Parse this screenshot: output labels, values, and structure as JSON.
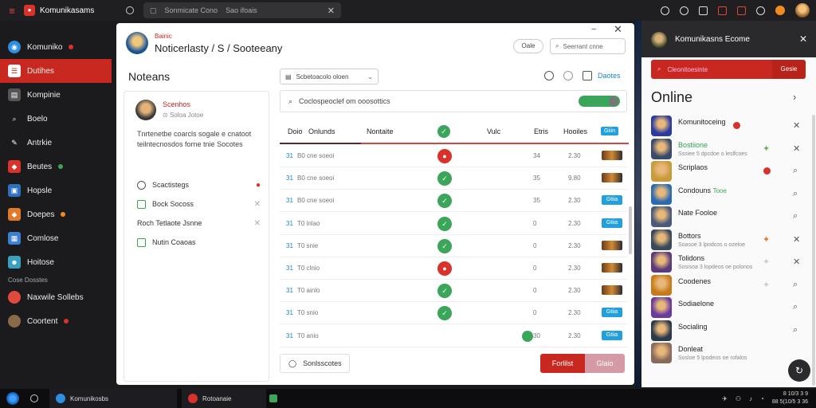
{
  "topbar": {
    "app_title": "Komunikasams",
    "search_text": "Sonmicate Cono",
    "search_hint": "Sao ifoais"
  },
  "nav": {
    "items": [
      {
        "label": "Komuniko",
        "color": "#2e8fe0",
        "badge": "red"
      },
      {
        "label": "Dutihes",
        "color": "#c8281f",
        "active": true
      },
      {
        "label": "Kompinie",
        "color": "#666666"
      },
      {
        "label": "Boelo",
        "color": "#666666"
      },
      {
        "label": "Antrkie",
        "color": "#666666"
      },
      {
        "label": "Beutes",
        "color": "#d8322a",
        "badge": "green"
      },
      {
        "label": "Hopsle",
        "color": "#2e6fbf"
      },
      {
        "label": "Doepes",
        "color": "#e07a2a",
        "badge": "orange"
      },
      {
        "label": "Comlose",
        "color": "#3a7fd0"
      },
      {
        "label": "Hoitose",
        "color": "#3aa0c0"
      }
    ],
    "section_label": "Cose Dosstes",
    "extra": [
      {
        "label": "Naxwile Sollebs",
        "color": "#e04a3a"
      },
      {
        "label": "Coortent",
        "color": "#8a6a4a",
        "badge": "red"
      }
    ]
  },
  "window": {
    "subtitle": "Bainic",
    "title": "Noticerlasty / S / Sooteeany",
    "pill": "Oale",
    "search_placeholder": "Seerrant cnne",
    "page_title": "Noteans",
    "minimize": "−",
    "close": "✕"
  },
  "sidecard": {
    "name": "Scenhos",
    "meta": "Soloa Jotoe",
    "description": "Tnrtenetbe coarcls sogale e cnatoot teilntecnosdos forne tnie Socotes",
    "items": [
      {
        "label": "Scactistegs",
        "end": "●",
        "end_color": "#d8322a",
        "round": true
      },
      {
        "label": "Bock Socoss",
        "end": "✕",
        "end_color": "#aaaaaa"
      },
      {
        "label": "Roch Tetlaote Jsnne",
        "end": "✕",
        "end_color": "#aaaaaa",
        "nobox": true
      },
      {
        "label": "Nutin Coaoas",
        "end": "",
        "end_color": "#aaaaaa"
      }
    ]
  },
  "toolbar": {
    "select_label": "Scbetoacolo oloen",
    "action_label": "Daotes"
  },
  "filter": {
    "placeholder": "Coclospeoclef om ooosottics"
  },
  "table": {
    "headers": {
      "c1": "Doio",
      "c2": "Onlunds",
      "c3": "Nontaite",
      "c4": "Vulc",
      "c5": "Etris",
      "c6": "Hooiles",
      "tag": "Giiin"
    },
    "rows": [
      {
        "id": "31",
        "name": "B0 cne soeoi",
        "status": "bad",
        "a": "34",
        "b": "2.30",
        "c": "img"
      },
      {
        "id": "31",
        "name": "B0 cne soeoi",
        "status": "ok",
        "a": "35",
        "b": "9.80",
        "c": "img"
      },
      {
        "id": "31",
        "name": "B0 cne soeoi",
        "status": "ok",
        "a": "35",
        "b": "2.30",
        "c": "blue",
        "c_label": "Gtiia"
      },
      {
        "id": "31",
        "name": "T0 inlao",
        "status": "ok",
        "a": "0",
        "b": "2.30",
        "c": "blue",
        "c_label": "Gtiia"
      },
      {
        "id": "31",
        "name": "T0 snie",
        "status": "ok",
        "a": "0",
        "b": "2.30",
        "c": "img"
      },
      {
        "id": "31",
        "name": "T0 clnio",
        "status": "bad",
        "a": "0",
        "b": "2.30",
        "c": "img"
      },
      {
        "id": "31",
        "name": "T0 ainlo",
        "status": "ok",
        "a": "0",
        "b": "2.30",
        "c": "img"
      },
      {
        "id": "31",
        "name": "T0 snio",
        "status": "ok",
        "a": "0",
        "b": "2.30",
        "c": "blue",
        "c_label": "Gtiia"
      },
      {
        "id": "31",
        "name": "T0 anio",
        "status": "",
        "a": "30",
        "b": "2.30",
        "c": "blue",
        "c_label": "Gtiia",
        "mini": true
      }
    ]
  },
  "footer": {
    "outline_label": "Sonlsscotes",
    "primary_label": "Forlilst",
    "secondary_label": "Glaio"
  },
  "rpanel": {
    "title": "Komunikasns Ecome",
    "search_placeholder": "Cleonitoesinte",
    "go_label": "Gesie",
    "online_title": "Online",
    "contacts": [
      {
        "name": "Komunitoceing",
        "sub": "",
        "av": "#2a3aa0",
        "dot": true,
        "act": "✕"
      },
      {
        "name": "Bostiione",
        "sub": "Sssiee 5 dpcdoe o leslfcoes",
        "av": "#3a4a6a",
        "green": true,
        "leaf": true,
        "act": "✕"
      },
      {
        "name": "Scriplaos",
        "sub": "",
        "av": "#c89a3a",
        "dot2": true,
        "act": "⌕"
      },
      {
        "name": "Condouns",
        "tag": "Tooe",
        "sub": "",
        "av": "#2a6ab0",
        "act": "⌕"
      },
      {
        "name": "Nate Fooloe",
        "sub": "",
        "av": "#4a5a7a",
        "act": "⌕"
      },
      {
        "name": "Bottors",
        "sub": "Soasoe 3 lpodcos o ozeloe",
        "av": "#3a4a5a",
        "leaf2": true,
        "act": "✕"
      },
      {
        "name": "Tolidons",
        "sub": "Sosisoa 3 lopdeos oe polonos",
        "av": "#5a3a7a",
        "leaf3": true,
        "act": "✕"
      },
      {
        "name": "Coodenes",
        "sub": "",
        "av": "#c87a1a",
        "leaf3": true,
        "act": "⌕"
      },
      {
        "name": "Sodiaelone",
        "sub": "",
        "av": "#6a3aa0",
        "act": "⌕"
      },
      {
        "name": "Socialing",
        "sub": "",
        "av": "#2a3a4a",
        "act": "⌕"
      },
      {
        "name": "Donleat",
        "sub": "Sosloe 5 lpodeos oe rofalos",
        "av": "#8a6a5a",
        "act": ""
      }
    ]
  },
  "taskbar": {
    "app1": "Komunikosbs",
    "app2": "Rotoanaie",
    "time": "8 10/3 3 9",
    "date": "88 5(10/5 3 36"
  }
}
